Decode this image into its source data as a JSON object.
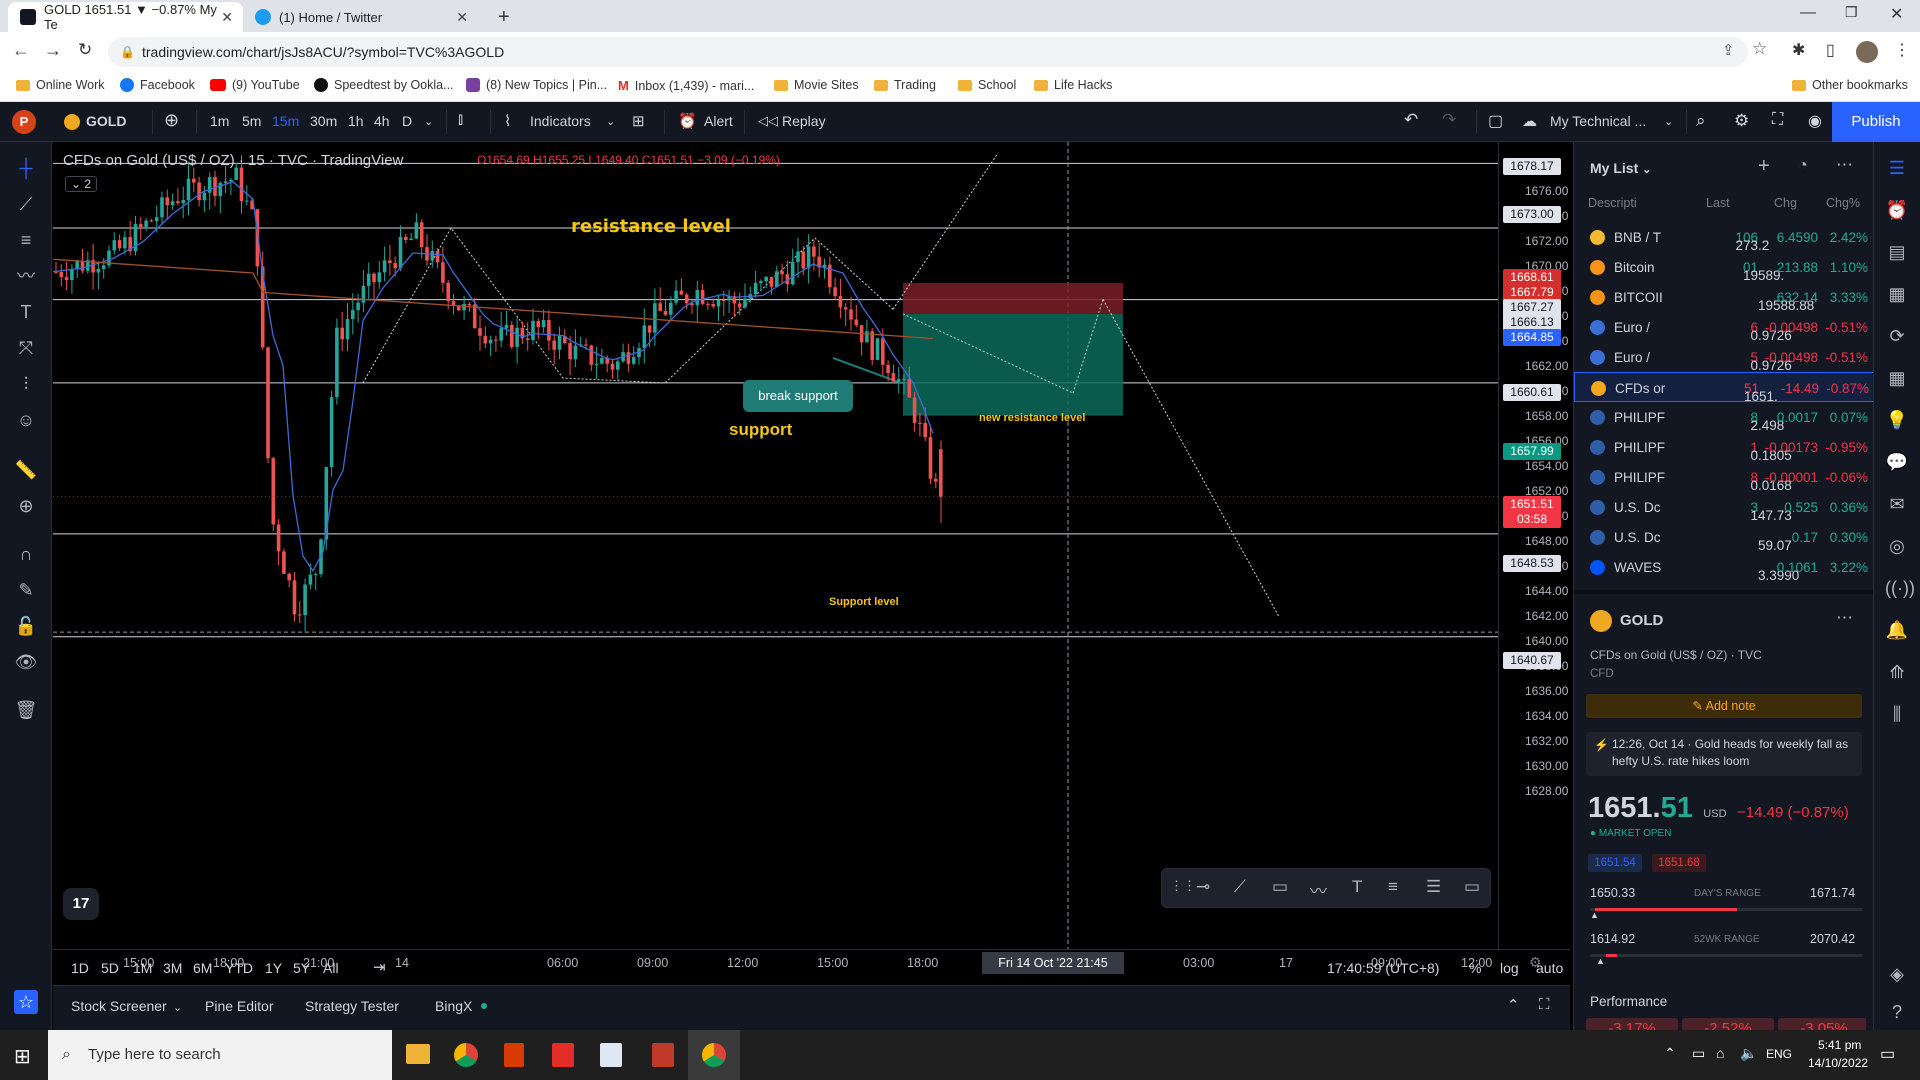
{
  "browser": {
    "tabs": [
      {
        "title": "GOLD 1651.51 ▼ −0.87% My Te",
        "active": true
      },
      {
        "title": "(1) Home / Twitter",
        "active": false
      }
    ],
    "url": "tradingview.com/chart/jsJs8ACU/?symbol=TVC%3AGOLD",
    "bookmarks": [
      "Online Work",
      "Facebook",
      "(9) YouTube",
      "Speedtest by Ookla...",
      "(8) New Topics | Pin...",
      "Inbox (1,439) - mari...",
      "Movie Sites",
      "Trading",
      "School",
      "Life Hacks"
    ],
    "other_bookmarks": "Other bookmarks"
  },
  "toolbar": {
    "symbol": "GOLD",
    "intervals": [
      "1m",
      "5m",
      "15m",
      "30m",
      "1h",
      "4h",
      "D"
    ],
    "active_interval": "15m",
    "indicators": "Indicators",
    "alert": "Alert",
    "replay": "Replay",
    "layout_name": "My Technical ...",
    "publish": "Publish"
  },
  "legend": {
    "title": "CFDs on Gold (US$ / OZ) · 15 · TVC · TradingView",
    "ohlc": "O1654.69 H1655.25 L1649.40 C1651.51 −3.09 (−0.19%)",
    "collapsed_count": "2"
  },
  "annotations": {
    "resistance": "resistance level",
    "break_support": "break support",
    "support": "support",
    "new_resistance": "new resistance level",
    "support_level": "Support level"
  },
  "price_ticks": [
    "1676.00",
    "1674.00",
    "1672.00",
    "1670.00",
    "1668.00",
    "1666.00",
    "1664.00",
    "1662.00",
    "1660.00",
    "1658.00",
    "1656.00",
    "1654.00",
    "1652.00",
    "1650.00",
    "1648.00",
    "1646.00",
    "1644.00",
    "1642.00",
    "1640.00",
    "1638.00",
    "1636.00",
    "1634.00",
    "1632.00",
    "1630.00",
    "1628.00"
  ],
  "price_labels": [
    {
      "text": "1678.17",
      "color": "#e0e3eb",
      "fg": "#131722"
    },
    {
      "text": "1673.00",
      "color": "#e0e3eb",
      "fg": "#131722"
    },
    {
      "text": "1668.61",
      "color": "#d32f2f",
      "fg": "#ffffff"
    },
    {
      "text": "1667.79",
      "color": "#d32f2f",
      "fg": "#ffffff"
    },
    {
      "text": "1667.27",
      "color": "#e0e3eb",
      "fg": "#131722"
    },
    {
      "text": "1666.13",
      "color": "#e0e3eb",
      "fg": "#131722"
    },
    {
      "text": "1664.85",
      "color": "#2962ff",
      "fg": "#ffffff"
    },
    {
      "text": "1660.61",
      "color": "#e0e3eb",
      "fg": "#131722"
    },
    {
      "text": "1657.99",
      "color": "#089981",
      "fg": "#ffffff"
    },
    {
      "text": "1651.51",
      "color": "#f23645",
      "fg": "#ffffff"
    },
    {
      "text": "03:58",
      "color": "#f23645",
      "fg": "#ffffff"
    },
    {
      "text": "1648.53",
      "color": "#e0e3eb",
      "fg": "#131722"
    },
    {
      "text": "1640.67",
      "color": "#e0e3eb",
      "fg": "#131722"
    }
  ],
  "time_ticks": [
    "15:00",
    "18:00",
    "21:00",
    "14",
    "06:00",
    "09:00",
    "12:00",
    "15:00",
    "18:00",
    "21:45",
    "03:00",
    "17",
    "09:00",
    "12:00"
  ],
  "crosshair_time": "Fri 14 Oct '22  21:45",
  "range_buttons": [
    "1D",
    "5D",
    "1M",
    "3M",
    "6M",
    "YTD",
    "1Y",
    "5Y",
    "All"
  ],
  "clock": "17:40:59 (UTC+8)",
  "scale_opts": [
    "%",
    "log",
    "auto"
  ],
  "bottom_tabs": [
    "Stock Screener",
    "Pine Editor",
    "Strategy Tester",
    "BingX"
  ],
  "watchlist": {
    "title": "My List",
    "headers": [
      "Descripti",
      "Last",
      "Chg",
      "Chg%"
    ],
    "rows": [
      {
        "name": "BNB / T",
        "last": "273.2",
        "last_tail": "106",
        "chg": "6.4590",
        "pct": "2.42%",
        "up": true,
        "icon": "#f3ba2f"
      },
      {
        "name": "Bitcoin",
        "last": "19589.",
        "last_tail": "01",
        "chg": "213.88",
        "pct": "1.10%",
        "up": true,
        "icon": "#f7931a"
      },
      {
        "name": "BITCOII",
        "last": "19588.88",
        "last_tail": "",
        "chg": "632.14",
        "pct": "3.33%",
        "up": true,
        "icon": "#f7931a"
      },
      {
        "name": "Euro /",
        "last": "0.9726",
        "last_tail": "6",
        "chg": "-0.00498",
        "pct": "-0.51%",
        "up": false,
        "icon": "#3a6fd8"
      },
      {
        "name": "Euro /",
        "last": "0.9726",
        "last_tail": "5",
        "chg": "-0.00498",
        "pct": "-0.51%",
        "up": false,
        "icon": "#3a6fd8"
      },
      {
        "name": "CFDs or",
        "last": "1651.",
        "last_tail": "51",
        "chg": "-14.49",
        "pct": "-0.87%",
        "up": false,
        "icon": "#f0a91f"
      },
      {
        "name": "PHILIPF",
        "last": "2.498",
        "last_tail": "8",
        "chg": "0.0017",
        "pct": "0.07%",
        "up": true,
        "icon": "#2e5ea8"
      },
      {
        "name": "PHILIPF",
        "last": "0.1805",
        "last_tail": "1",
        "chg": "-0.00173",
        "pct": "-0.95%",
        "up": false,
        "icon": "#2e5ea8"
      },
      {
        "name": "PHILIPF",
        "last": "0.0168",
        "last_tail": "8",
        "chg": "-0.00001",
        "pct": "-0.06%",
        "up": false,
        "icon": "#2e5ea8"
      },
      {
        "name": "U.S. Dc",
        "last": "147.73",
        "last_tail": "3",
        "chg": "0.525",
        "pct": "0.36%",
        "up": true,
        "icon": "#2e5ea8"
      },
      {
        "name": "U.S. Dc",
        "last": "59.07",
        "last_tail": "",
        "chg": "0.17",
        "pct": "0.30%",
        "up": true,
        "icon": "#2e5ea8"
      },
      {
        "name": "WAVES",
        "last": "3.3990",
        "last_tail": "",
        "chg": "0.1061",
        "pct": "3.22%",
        "up": true,
        "icon": "#0055ff"
      }
    ]
  },
  "details": {
    "symbol": "GOLD",
    "desc": "CFDs on Gold (US$ / OZ) · TVC",
    "type": "CFD",
    "add_note": "Add note",
    "news": "12:26, Oct 14 · Gold heads for weekly fall as hefty U.S. rate hikes loom",
    "price_main": "1651.",
    "price_tail": "51",
    "currency": "USD",
    "change": "−14.49 (−0.87%)",
    "market": "MARKET OPEN",
    "bid": "1651.54",
    "ask": "1651.68",
    "day_low": "1650.33",
    "day_label": "DAY'S RANGE",
    "day_high": "1671.74",
    "wk_low": "1614.92",
    "wk_label": "52WK RANGE",
    "wk_high": "2070.42",
    "performance": "Performance",
    "perf": [
      "-3.17%",
      "-2.52%",
      "-3.05%"
    ]
  },
  "taskbar": {
    "search": "Type here to search",
    "lang": "ENG",
    "time": "5:41 pm",
    "date": "14/10/2022"
  }
}
